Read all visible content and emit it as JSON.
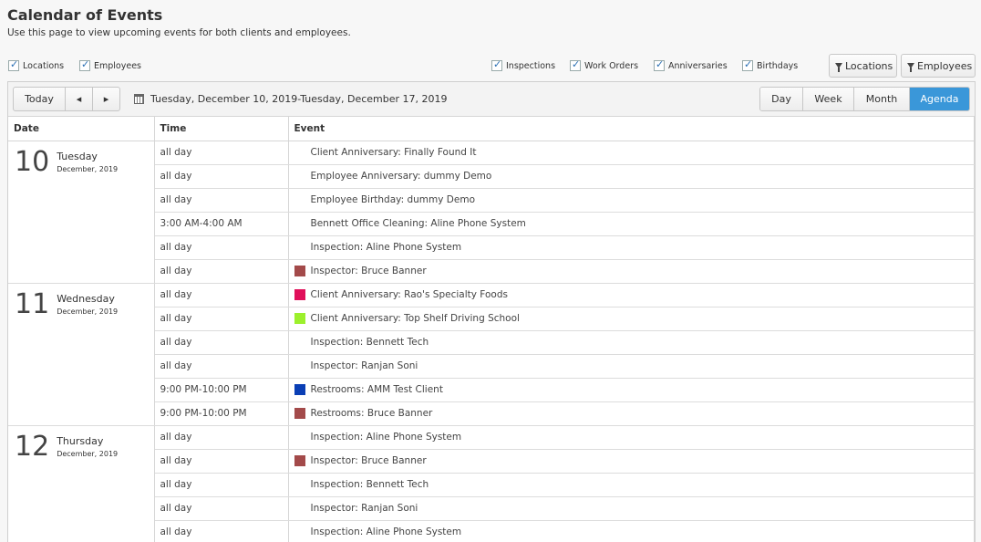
{
  "page": {
    "title": "Calendar of Events",
    "subtitle": "Use this page to view upcoming events for both clients and employees."
  },
  "filters": {
    "left": [
      "Locations",
      "Employees"
    ],
    "right": [
      "Inspections",
      "Work Orders",
      "Anniversaries",
      "Birthdays"
    ],
    "buttons": [
      "Locations",
      "Employees"
    ]
  },
  "toolbar": {
    "today": "Today",
    "prev": "◂",
    "next": "▸",
    "range": "Tuesday, December 10, 2019-Tuesday, December 17, 2019",
    "views": [
      "Day",
      "Week",
      "Month",
      "Agenda"
    ],
    "active_view": "Agenda"
  },
  "columns": [
    "Date",
    "Time",
    "Event"
  ],
  "days": [
    {
      "num": "10",
      "name": "Tuesday",
      "monthyear": "December, 2019",
      "events": [
        {
          "time": "all day",
          "title": "Client Anniversary: Finally Found It",
          "color": null
        },
        {
          "time": "all day",
          "title": "Employee Anniversary: dummy Demo",
          "color": null
        },
        {
          "time": "all day",
          "title": "Employee Birthday: dummy Demo",
          "color": null
        },
        {
          "time": "3:00 AM-4:00 AM",
          "title": "Bennett Office Cleaning: Aline Phone System",
          "color": null
        },
        {
          "time": "all day",
          "title": "Inspection: Aline Phone System",
          "color": null
        },
        {
          "time": "all day",
          "title": "Inspector: Bruce Banner",
          "color": "#a34a4a"
        }
      ]
    },
    {
      "num": "11",
      "name": "Wednesday",
      "monthyear": "December, 2019",
      "events": [
        {
          "time": "all day",
          "title": "Client Anniversary: Rao's Specialty Foods",
          "color": "#e0105a"
        },
        {
          "time": "all day",
          "title": "Client Anniversary: Top Shelf Driving School",
          "color": "#9cf02c"
        },
        {
          "time": "all day",
          "title": "Inspection: Bennett Tech",
          "color": null
        },
        {
          "time": "all day",
          "title": "Inspector: Ranjan Soni",
          "color": null
        },
        {
          "time": "9:00 PM-10:00 PM",
          "title": "Restrooms: AMM Test Client",
          "color": "#0a3fb5"
        },
        {
          "time": "9:00 PM-10:00 PM",
          "title": "Restrooms: Bruce Banner",
          "color": "#a34a4a"
        }
      ]
    },
    {
      "num": "12",
      "name": "Thursday",
      "monthyear": "December, 2019",
      "events": [
        {
          "time": "all day",
          "title": "Inspection: Aline Phone System",
          "color": null
        },
        {
          "time": "all day",
          "title": "Inspector: Bruce Banner",
          "color": "#a34a4a"
        },
        {
          "time": "all day",
          "title": "Inspection: Bennett Tech",
          "color": null
        },
        {
          "time": "all day",
          "title": "Inspector: Ranjan Soni",
          "color": null
        },
        {
          "time": "all day",
          "title": "Inspection: Aline Phone System",
          "color": null
        }
      ]
    }
  ]
}
